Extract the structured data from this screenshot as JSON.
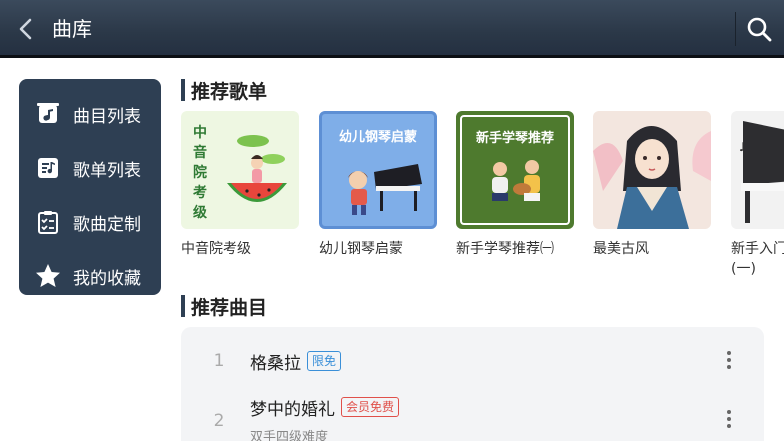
{
  "header": {
    "title": "曲库"
  },
  "sidebar": {
    "items": [
      {
        "label": "曲目列表",
        "icon": "music-list-icon"
      },
      {
        "label": "歌单列表",
        "icon": "playlist-icon"
      },
      {
        "label": "歌曲定制",
        "icon": "clipboard-check-icon"
      },
      {
        "label": "我的收藏",
        "icon": "star-icon"
      }
    ]
  },
  "recommended_playlists": {
    "title": "推荐歌单",
    "items": [
      {
        "name": "中音院考级",
        "cover_text": "中音院考级"
      },
      {
        "name": "幼儿钢琴启蒙",
        "cover_text": "幼儿钢琴启蒙"
      },
      {
        "name": "新手学琴推荐㈠",
        "cover_text": "新手学琴推荐"
      },
      {
        "name": "最美古风",
        "cover_text": ""
      },
      {
        "name": "新手入门",
        "name_line2": "(一)",
        "cover_text": ""
      }
    ]
  },
  "recommended_songs": {
    "title": "推荐曲目",
    "items": [
      {
        "index": "1",
        "name": "格桑拉",
        "tag": "限免",
        "tag_color": "#3a8fd8",
        "subtitle": ""
      },
      {
        "index": "2",
        "name": "梦中的婚礼",
        "tag": "会员免费",
        "tag_color": "#e0504a",
        "subtitle": "双手四级难度"
      }
    ]
  },
  "colors": {
    "header_bg": "#2b3848",
    "sidebar_bg": "#2e3f53",
    "accent_blue": "#3a8fd8",
    "accent_red": "#e0504a"
  }
}
